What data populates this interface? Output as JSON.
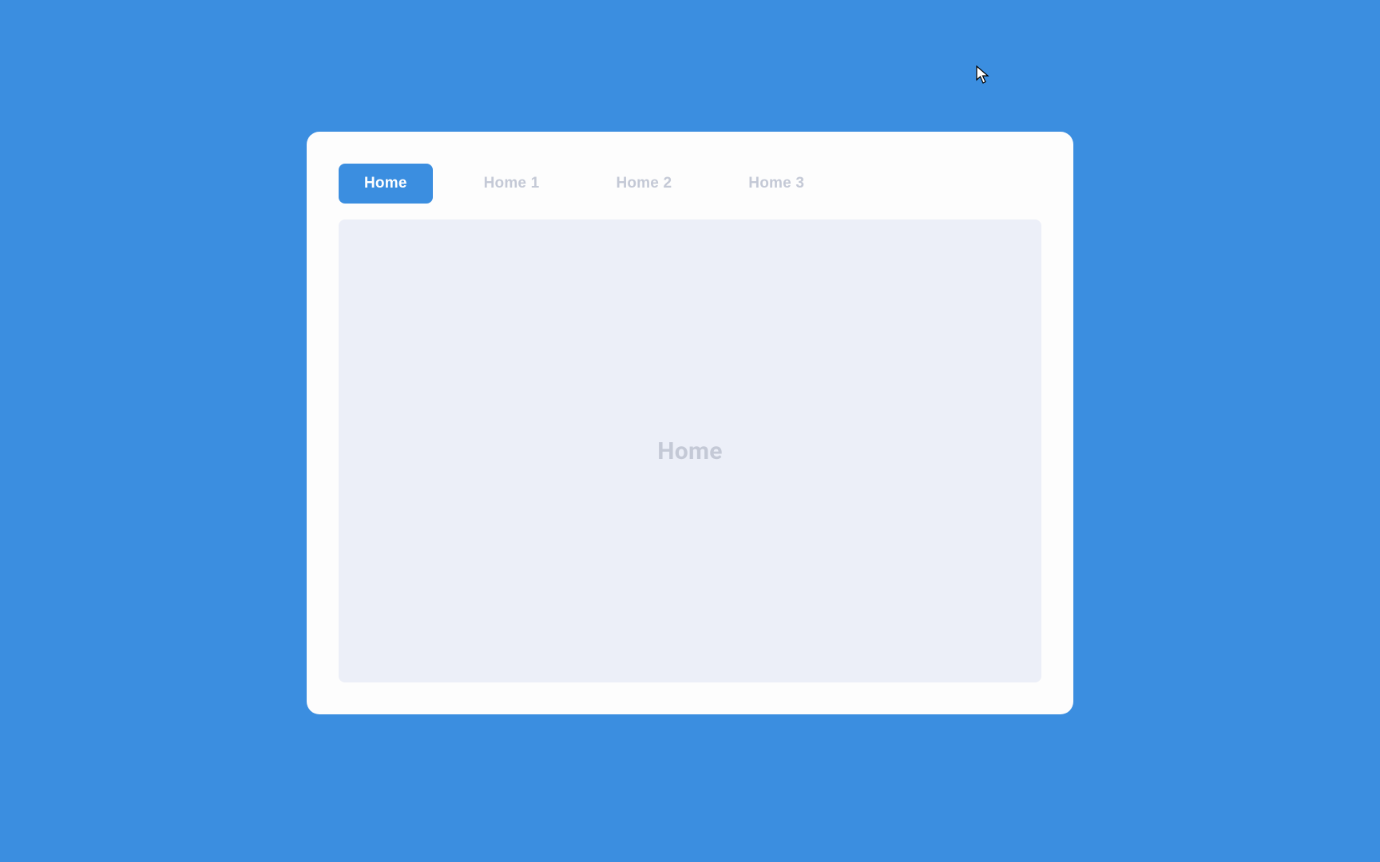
{
  "tabs": {
    "items": [
      {
        "label": "Home",
        "active": true
      },
      {
        "label": "Home 1",
        "active": false
      },
      {
        "label": "Home 2",
        "active": false
      },
      {
        "label": "Home 3",
        "active": false
      }
    ]
  },
  "content": {
    "label": "Home"
  },
  "colors": {
    "background": "#3b8ee0",
    "card": "#fdfdfd",
    "tab_active_bg": "#3b8ee0",
    "tab_active_text": "#ffffff",
    "tab_inactive_text": "#c4c9d6",
    "content_bg": "#eceff8",
    "content_text": "#c4c9d6"
  }
}
